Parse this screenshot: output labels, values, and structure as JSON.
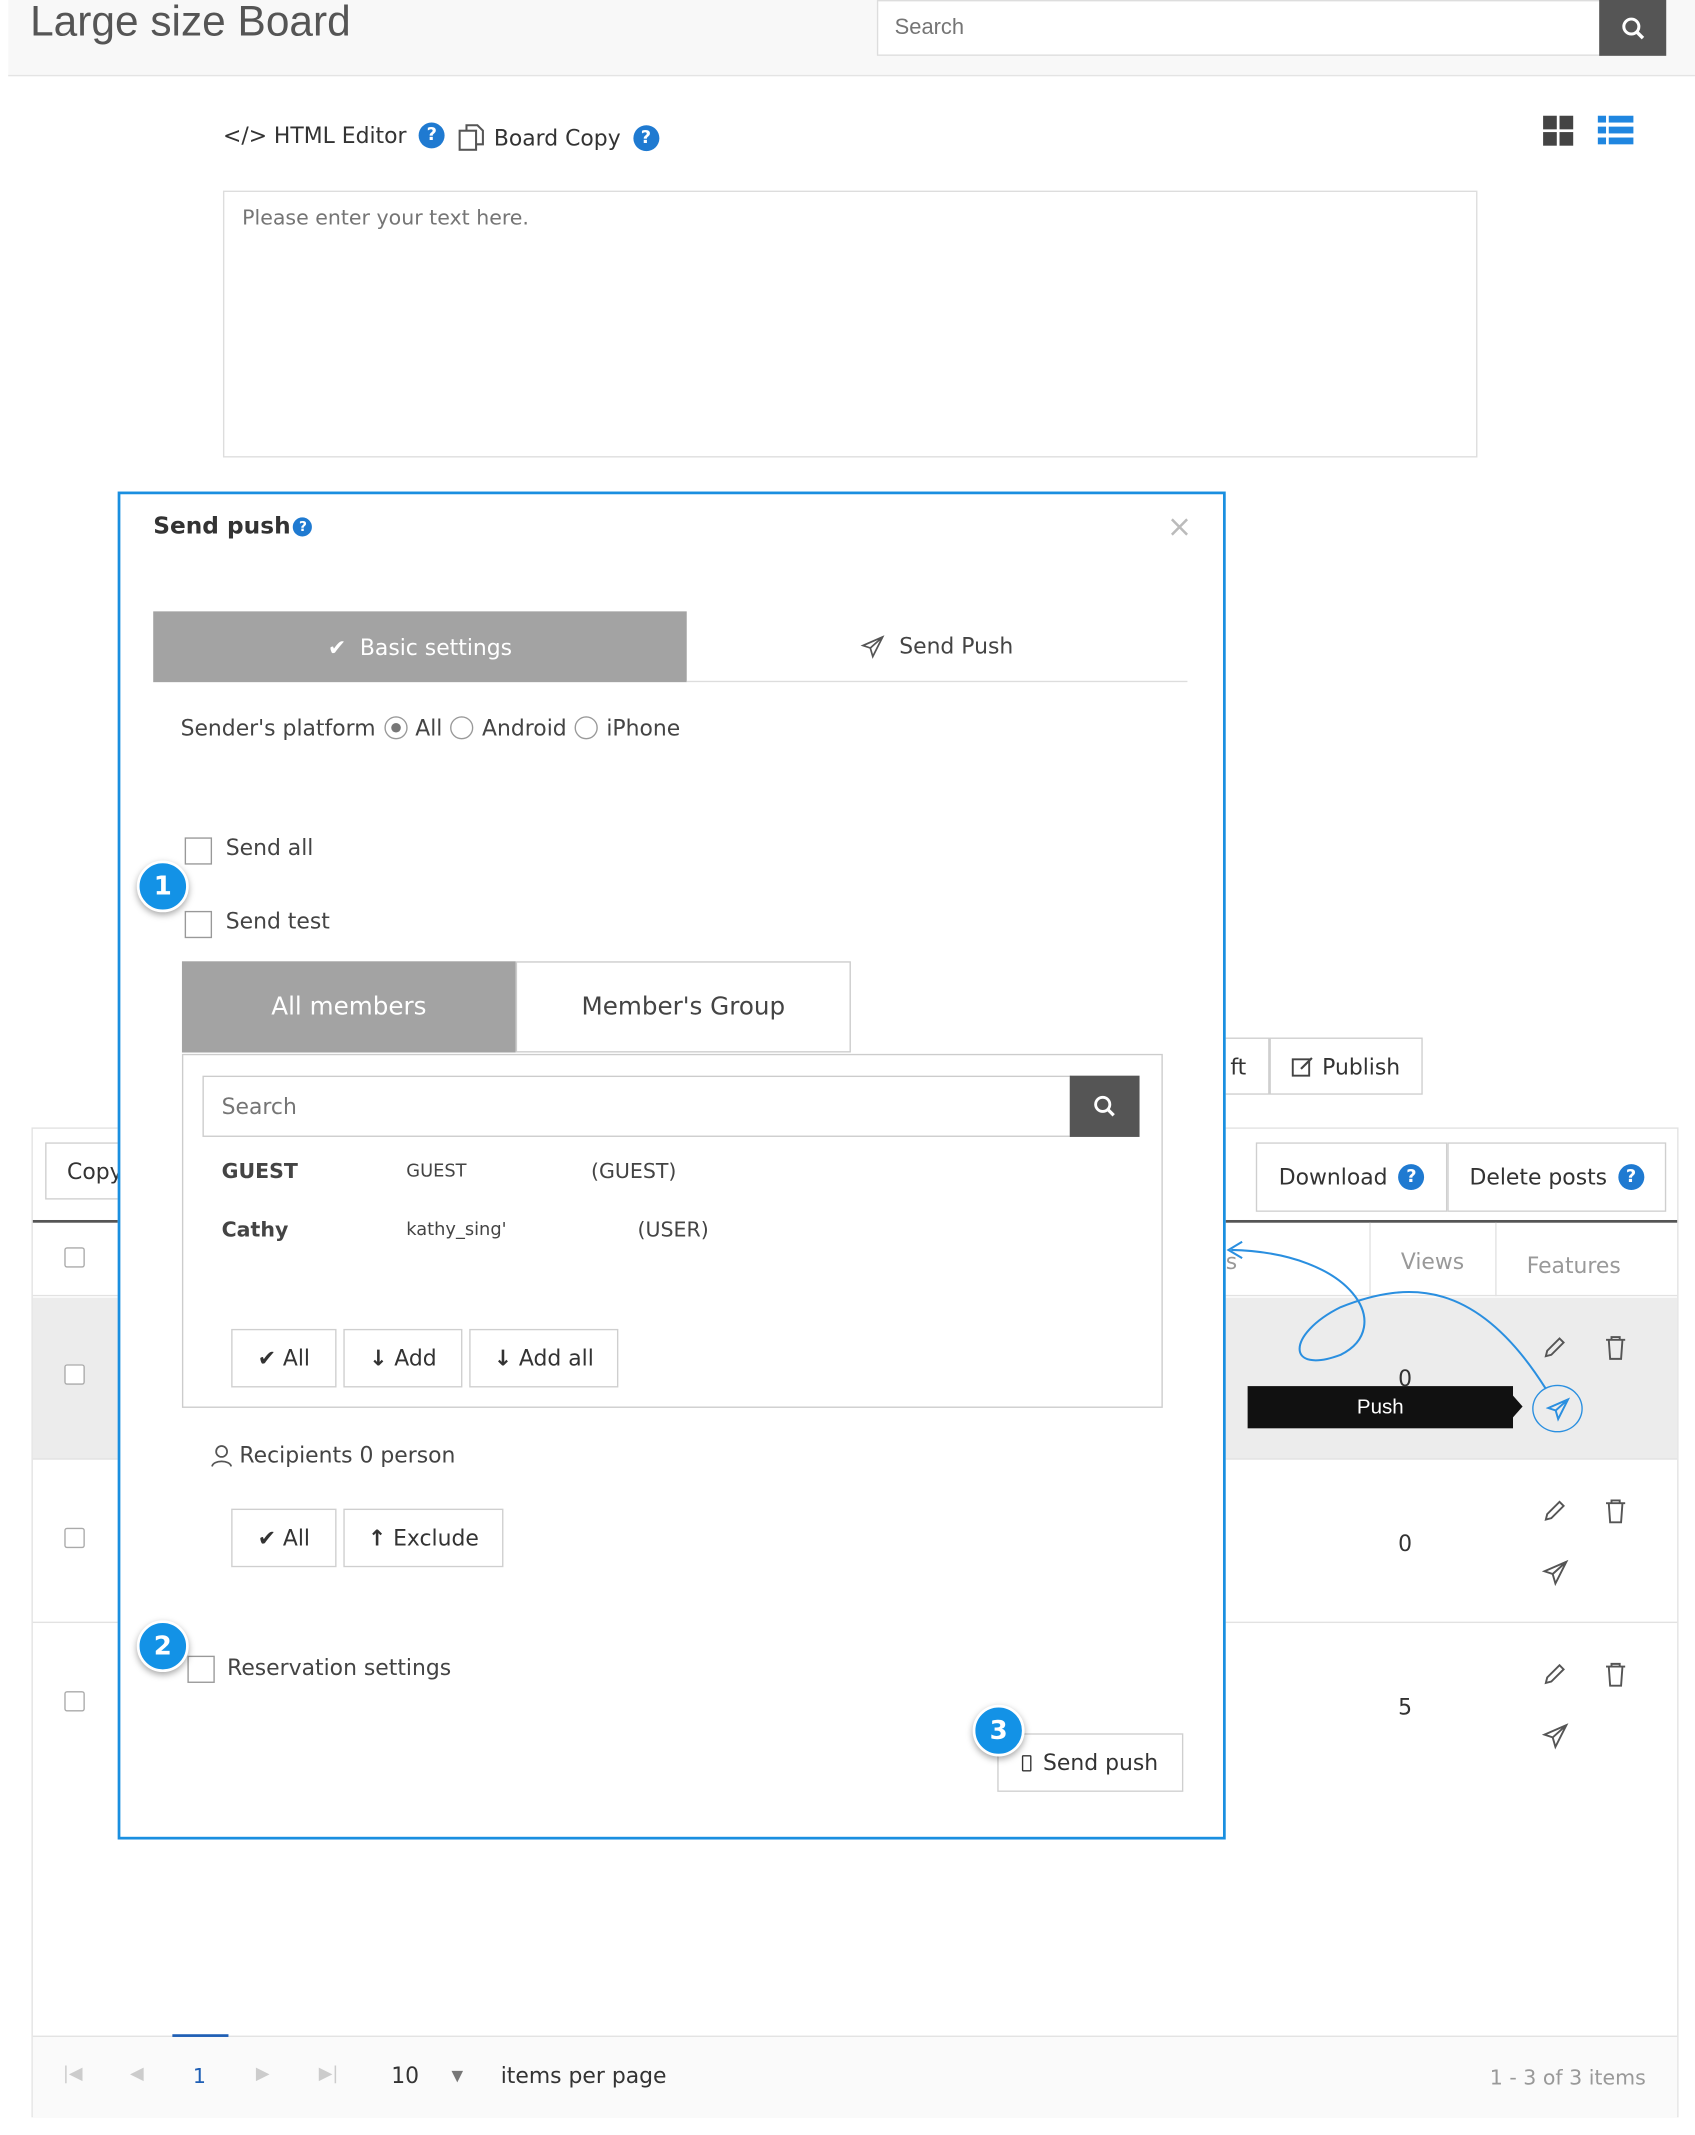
{
  "header": {
    "title": "Large size Board",
    "search_placeholder": "Search"
  },
  "editor": {
    "html_editor": "HTML Editor",
    "board_copy": "Board Copy",
    "placeholder": "Please enter your text here."
  },
  "toolbar": {
    "draft_partial": "ft",
    "publish": "Publish",
    "copy_partial": "Copy",
    "download": "Download",
    "delete_posts": "Delete posts"
  },
  "table": {
    "columns": {
      "partial": "s",
      "views": "Views",
      "features": "Features"
    },
    "rows": [
      {
        "views": "0"
      },
      {
        "views": "0"
      },
      {
        "views": "5"
      }
    ],
    "tooltip": "Push"
  },
  "pagination": {
    "current_page": "1",
    "page_size": "10",
    "per_page_label": "items per page",
    "summary": "1 - 3 of 3 items"
  },
  "modal": {
    "title": "Send push",
    "close": "×",
    "tabs": {
      "basic": "Basic settings",
      "send": "Send Push"
    },
    "platform": {
      "label": "Sender's platform",
      "options": [
        "All",
        "Android",
        "iPhone"
      ],
      "selected": "All"
    },
    "send_all": "Send all",
    "send_test": "Send test",
    "member_tabs": {
      "all": "All members",
      "group": "Member's Group"
    },
    "member_search_placeholder": "Search",
    "members": [
      {
        "name": "GUEST",
        "id": "GUEST",
        "role": "(GUEST)"
      },
      {
        "name": "Cathy",
        "id": "kathy_sing'",
        "role": "(USER)"
      }
    ],
    "member_buttons": {
      "all": "All",
      "add": "Add",
      "add_all": "Add all"
    },
    "recipients": "Recipients 0 person",
    "recipient_buttons": {
      "all": "All",
      "exclude": "Exclude"
    },
    "reservation": "Reservation settings",
    "send_button": "Send push"
  },
  "annotations": {
    "badge1": "1",
    "badge2": "2",
    "badge3": "3"
  },
  "colors": {
    "accent": "#1f7ad1",
    "badge": "#1392e6",
    "modal_border": "#1a8fe0",
    "tab_active": "#a3a3a3",
    "tooltip_bg": "#111111"
  }
}
